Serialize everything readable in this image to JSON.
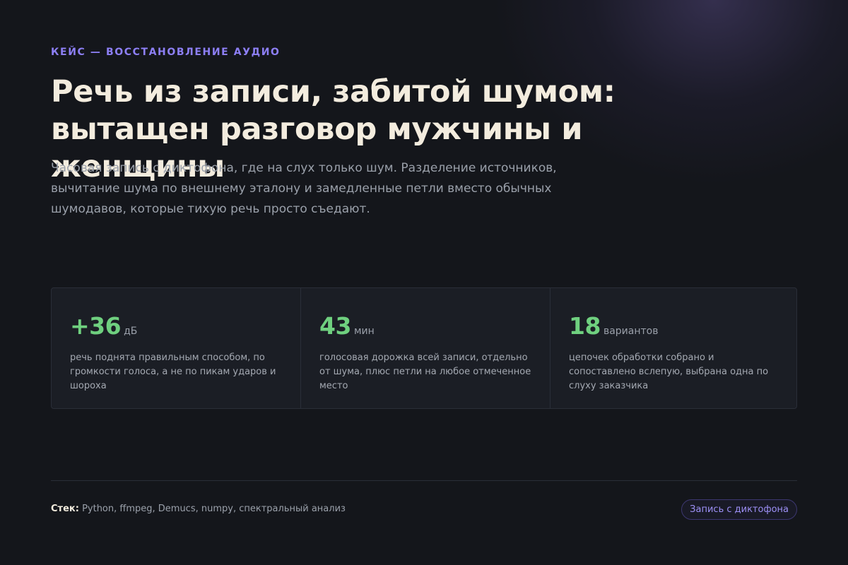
{
  "eyebrow": "КЕЙС — ВОССТАНОВЛЕНИЕ АУДИО",
  "title": {
    "line1": "Речь из записи, забитой шумом:",
    "line2": "вытащен разговор мужчины и женщины"
  },
  "lead": "Часовая запись с диктофона, где на слух только шум. Разделение источников, вычитание шума по внешнему эталону и замедленные петли вместо обычных шумодавов, которые тихую речь просто съедают.",
  "stats": [
    {
      "value": "+36",
      "unit": "дБ",
      "desc": "речь поднята правильным способом, по громкости голоса, а не по пикам ударов и шороха"
    },
    {
      "value": "43",
      "unit": "мин",
      "desc": "голосовая дорожка всей записи, отдельно от шума, плюс петли на любое отмеченное место"
    },
    {
      "value": "18",
      "unit": "вариантов",
      "desc": "цепочек обработки собрано и сопоставлено вслепую, выбрана одна по слуху заказчика"
    }
  ],
  "footer": {
    "stack_label": "Стек:",
    "stack_items": "Python, ffmpeg, Demucs, numpy, спектральный анализ",
    "tag": "Запись с диктофона"
  },
  "colors": {
    "background": "#14161b",
    "accent": "#8d7ff5",
    "stat_value": "#6fd07f",
    "title": "#f3ecde"
  }
}
